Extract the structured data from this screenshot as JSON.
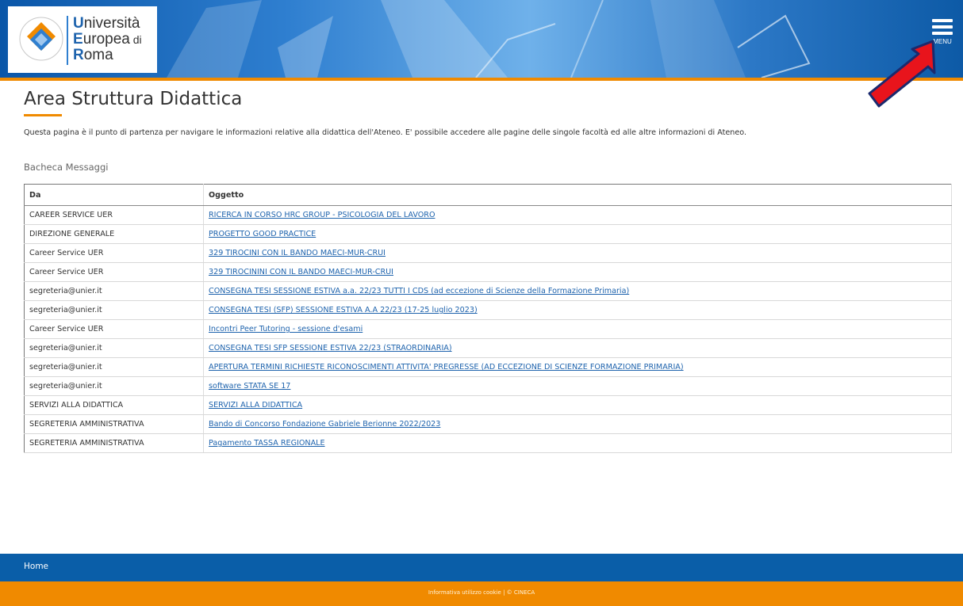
{
  "header": {
    "logo": {
      "line1_cap": "U",
      "line1_rest": "niversità",
      "line2_cap": "E",
      "line2_rest": "uropea",
      "line2_small": " di",
      "line3_cap": "R",
      "line3_rest": "oma"
    },
    "menu_label": "MENU"
  },
  "page": {
    "title": "Area Struttura Didattica",
    "intro": "Questa pagina è il punto di partenza per navigare le informazioni relative alla didattica dell'Ateneo. E' possibile accedere alle pagine delle singole facoltà ed alle altre informazioni di Ateneo.",
    "section_title": "Bacheca Messaggi"
  },
  "table": {
    "headers": [
      "Da",
      "Oggetto"
    ],
    "rows": [
      {
        "da": "CAREER SERVICE UER",
        "oggetto": "RICERCA IN CORSO HRC GROUP - PSICOLOGIA DEL LAVORO"
      },
      {
        "da": "DIREZIONE GENERALE",
        "oggetto": "PROGETTO GOOD PRACTICE"
      },
      {
        "da": "Career Service UER",
        "oggetto": "329 TIROCINI CON IL BANDO MAECI-MUR-CRUI"
      },
      {
        "da": "Career Service UER",
        "oggetto": "329 TIROCININI CON IL BANDO MAECI-MUR-CRUI"
      },
      {
        "da": "segreteria@unier.it",
        "oggetto": "CONSEGNA TESI SESSIONE ESTIVA a.a. 22/23 TUTTI I CDS (ad eccezione di Scienze della Formazione Primaria)"
      },
      {
        "da": "segreteria@unier.it",
        "oggetto": "CONSEGNA TESI (SFP) SESSIONE ESTIVA A.A 22/23 (17-25 luglio 2023)"
      },
      {
        "da": "Career Service UER",
        "oggetto": "Incontri Peer Tutoring - sessione d'esami"
      },
      {
        "da": "segreteria@unier.it",
        "oggetto": "CONSEGNA TESI SFP SESSIONE ESTIVA 22/23 (STRAORDINARIA)"
      },
      {
        "da": "segreteria@unier.it",
        "oggetto": "APERTURA TERMINI RICHIESTE RICONOSCIMENTI ATTIVITA' PREGRESSE (AD ECCEZIONE DI SCIENZE FORMAZIONE PRIMARIA)"
      },
      {
        "da": "segreteria@unier.it",
        "oggetto": "software STATA SE 17"
      },
      {
        "da": "SERVIZI ALLA DIDATTICA",
        "oggetto": "SERVIZI ALLA DIDATTICA"
      },
      {
        "da": "SEGRETERIA AMMINISTRATIVA",
        "oggetto": "Bando di Concorso Fondazione Gabriele Berionne 2022/2023"
      },
      {
        "da": "SEGRETERIA AMMINISTRATIVA",
        "oggetto": "Pagamento TASSA REGIONALE"
      }
    ]
  },
  "footer": {
    "home_label": "Home",
    "cookie_text": "Informativa utilizzo cookie | © CINECA"
  },
  "colors": {
    "primary_blue": "#0a5ea8",
    "accent_orange": "#f08a00",
    "link_blue": "#1e63ad",
    "arrow_red": "#e8141c"
  },
  "icons": {
    "menu": "hamburger-icon",
    "annotation": "red-arrow-icon"
  }
}
